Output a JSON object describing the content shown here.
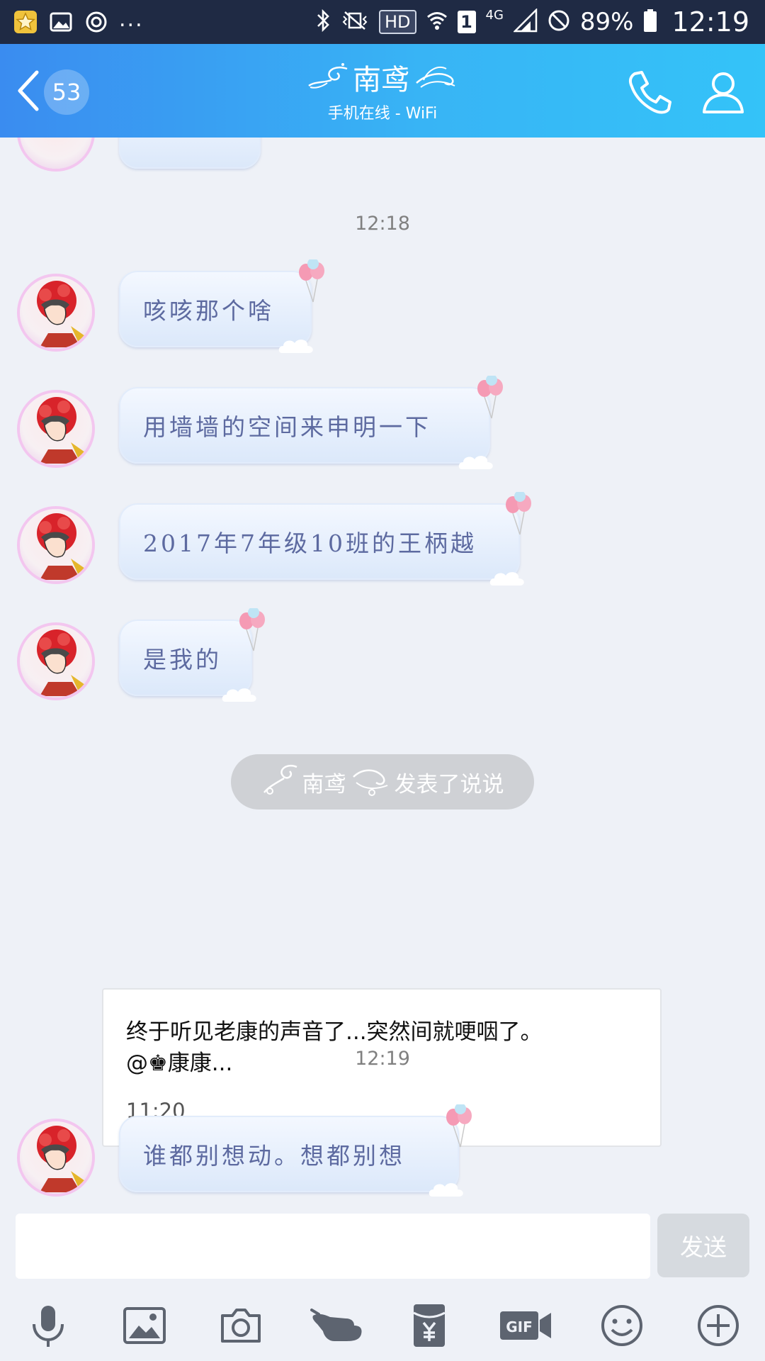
{
  "status_bar": {
    "network": "4G",
    "sim": "1",
    "hd": "HD",
    "battery": "89%",
    "time": "12:19",
    "more": "..."
  },
  "header": {
    "unread_count": "53",
    "contact_name": "南鸢",
    "status": "手机在线 - WiFi"
  },
  "messages": [
    {
      "type": "time",
      "text": "12:18"
    },
    {
      "type": "bubble",
      "text": "咳咳那个啥"
    },
    {
      "type": "bubble",
      "text": "用墙墙的空间来申明一下"
    },
    {
      "type": "bubble",
      "text": "2017年7年级10班的王柄越"
    },
    {
      "type": "bubble",
      "text": "是我的"
    }
  ],
  "notice": {
    "name": "南鸢",
    "action": "发表了说说"
  },
  "post_card": {
    "text_line1": "终于听见老康的声音了...突然间就哽咽了。",
    "text_line2": "@♚康康...",
    "time": "11:20"
  },
  "later": [
    {
      "type": "time",
      "text": "12:19"
    },
    {
      "type": "bubble",
      "text": "谁都别想动。想都别想"
    }
  ],
  "input": {
    "placeholder": "",
    "send_label": "发送"
  },
  "toolbar_icons": [
    "microphone-icon",
    "image-icon",
    "camera-icon",
    "poke-icon",
    "red-packet-icon",
    "gif-icon",
    "emoji-icon",
    "plus-icon"
  ],
  "colors": {
    "header_start": "#3a8cf0",
    "header_end": "#34c3f8",
    "bubble_text": "#5d6aa0",
    "background": "#eef1f7"
  }
}
